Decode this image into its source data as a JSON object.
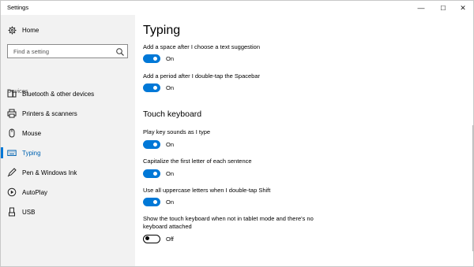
{
  "window": {
    "title": "Settings",
    "controls": {
      "minimize": "—",
      "maximize": "☐",
      "close": "✕"
    }
  },
  "sidebar": {
    "home_label": "Home",
    "search": {
      "placeholder": "Find a setting",
      "value": ""
    },
    "section_label": "Devices",
    "items": [
      {
        "label": "Bluetooth & other devices",
        "icon": "bluetooth-devices-icon",
        "active": false
      },
      {
        "label": "Printers & scanners",
        "icon": "printer-icon",
        "active": false
      },
      {
        "label": "Mouse",
        "icon": "mouse-icon",
        "active": false
      },
      {
        "label": "Typing",
        "icon": "keyboard-icon",
        "active": true
      },
      {
        "label": "Pen & Windows Ink",
        "icon": "pen-icon",
        "active": false
      },
      {
        "label": "AutoPlay",
        "icon": "autoplay-icon",
        "active": false
      },
      {
        "label": "USB",
        "icon": "usb-icon",
        "active": false
      }
    ]
  },
  "main": {
    "title": "Typing",
    "settings_top": [
      {
        "label": "Add a space after I choose a text suggestion",
        "state": "On",
        "on": true
      },
      {
        "label": "Add a period after I double-tap the Spacebar",
        "state": "On",
        "on": true
      }
    ],
    "touch_heading": "Touch keyboard",
    "settings_touch": [
      {
        "label": "Play key sounds as I type",
        "state": "On",
        "on": true
      },
      {
        "label": "Capitalize the first letter of each sentence",
        "state": "On",
        "on": true
      },
      {
        "label": "Use all uppercase letters when I double-tap Shift",
        "state": "On",
        "on": true
      },
      {
        "label": "Show the touch keyboard when not in tablet mode and there's no keyboard attached",
        "state": "Off",
        "on": false
      }
    ]
  },
  "colors": {
    "accent": "#0078d7",
    "sidebar_bg": "#f2f2f2"
  }
}
